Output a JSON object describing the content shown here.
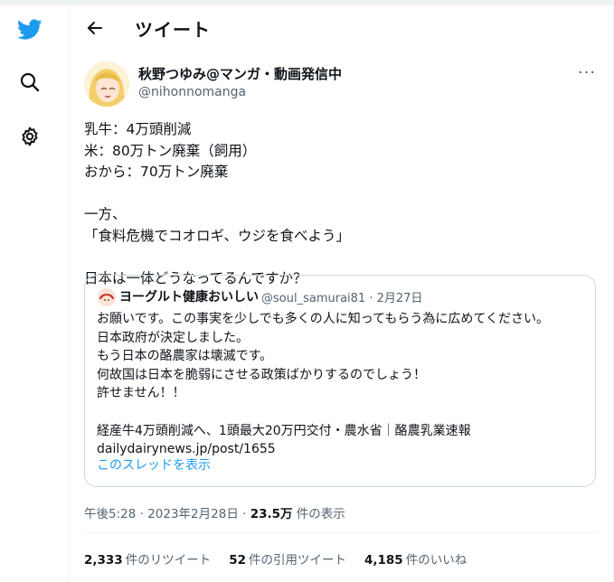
{
  "sidebar": {
    "icons": [
      "twitter-logo-icon",
      "search-icon",
      "gear-icon"
    ],
    "accent_color": "#1d9bf0"
  },
  "header": {
    "back_icon": "arrow-left-icon",
    "title": "ツイート"
  },
  "tweet": {
    "author_name": "秋野つゆみ@マンガ・動画発信中",
    "author_handle": "@nihonnomanga",
    "more_icon": "more-horizontal-icon",
    "more_label": "···",
    "text_lines": [
      "乳牛：4万頭削減",
      "米：80万トン廃棄（飼用）",
      "おから：70万トン廃棄",
      "",
      "一方、",
      "「食料危機でコオロギ、ウジを食べよう」",
      "",
      "日本は一体どうなってるんですか？"
    ],
    "quote": {
      "author_name": "ヨーグルト健康おいしい",
      "author_handle": "@soul_samurai81 · 2月27日",
      "text_lines": [
        "お願いです。この事実を少しでも多くの人に知ってもらう為に広めてください。",
        "日本政府が決定しました。",
        "もう日本の酪農家は壊滅です。",
        "何故国は日本を脆弱にさせる政策ばかりするのでしょう！",
        "許せません！！",
        "",
        "経産牛4万頭削減へ、1頭最大20万円交付・農水省｜酪農乳業速報",
        "dailydairynews.jp/post/1655"
      ],
      "show_thread": "このスレッドを表示"
    },
    "meta": {
      "time": "午後5:28 · 2023年2月28日 · ",
      "views_count": "23.5万",
      "views_label": " 件の表示"
    },
    "stats": [
      {
        "count": "2,333",
        "label": "件のリツイート"
      },
      {
        "count": "52",
        "label": "件の引用ツイート"
      },
      {
        "count": "4,185",
        "label": "件のいいね"
      }
    ]
  }
}
